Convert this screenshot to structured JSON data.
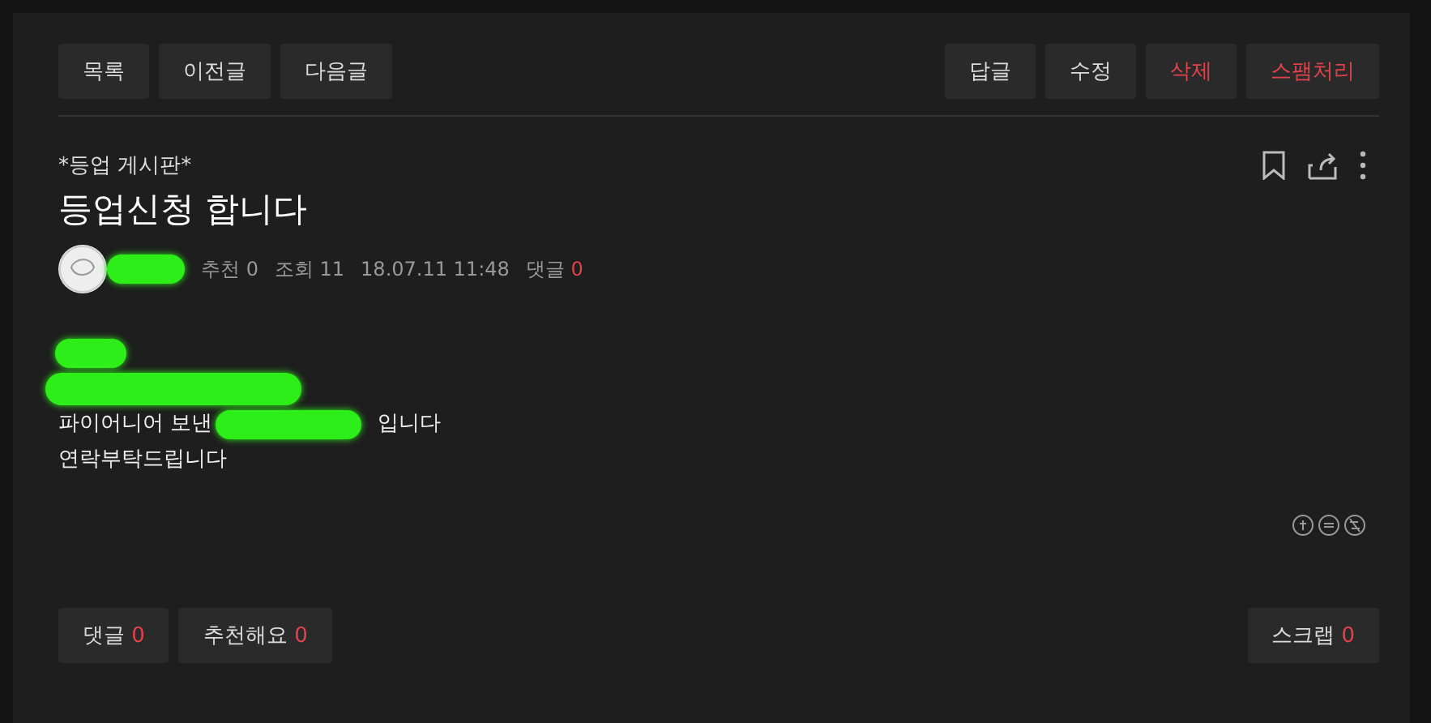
{
  "toolbar": {
    "left_buttons": [
      {
        "label": "목록",
        "kind": "normal"
      },
      {
        "label": "이전글",
        "kind": "normal"
      },
      {
        "label": "다음글",
        "kind": "normal"
      }
    ],
    "right_buttons": [
      {
        "label": "답글",
        "kind": "normal"
      },
      {
        "label": "수정",
        "kind": "normal"
      },
      {
        "label": "삭제",
        "kind": "danger"
      },
      {
        "label": "스팸처리",
        "kind": "danger"
      }
    ]
  },
  "post": {
    "board": "*등업 게시판*",
    "title": "등업신청 합니다",
    "meta": {
      "recommend": "추천 0",
      "views": "조회 11",
      "date": "18.07.11 11:48",
      "comments_label": "댓글",
      "comments_count": "0"
    },
    "body": [
      [
        {
          "kind": "redacted"
        }
      ],
      [
        {
          "kind": "redacted"
        }
      ],
      [
        {
          "kind": "text",
          "text": "파이어니어 보낸"
        },
        {
          "kind": "redacted"
        },
        {
          "kind": "text",
          "text": "입니다"
        }
      ],
      [
        {
          "kind": "text",
          "text": "연락부탁드립니다"
        }
      ]
    ]
  },
  "footer": {
    "left_buttons": [
      {
        "label": "댓글",
        "count": "0",
        "kind": "normal"
      },
      {
        "label": "추천해요",
        "count": "0",
        "kind": "normal"
      }
    ],
    "right_buttons": [
      {
        "label": "스크랩",
        "count": "0",
        "kind": "normal"
      }
    ]
  }
}
